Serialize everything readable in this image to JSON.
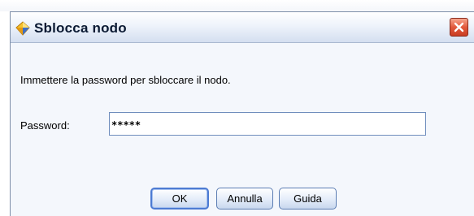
{
  "dialog": {
    "title": "Sblocca nodo",
    "title_icon": "node-shield-icon",
    "close_icon": "close-icon",
    "message": "Immettere la password per sbloccare il nodo.",
    "password_label": "Password:",
    "password_value": "*****",
    "buttons": {
      "ok": "OK",
      "cancel": "Annulla",
      "help": "Guida"
    },
    "colors": {
      "title_text": "#0b1a33",
      "close_button": "#d9482c",
      "button_border": "#5b7db3",
      "focus_border": "#4d7bd3"
    }
  }
}
